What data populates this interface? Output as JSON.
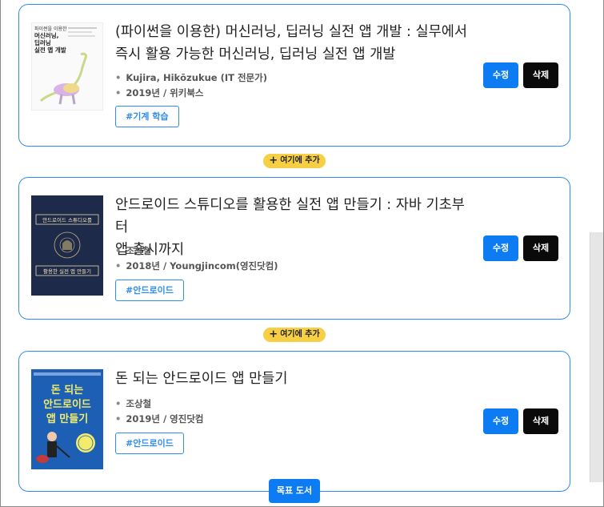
{
  "books": [
    {
      "title_line1": "(파이썬을 이용한) 머신러닝, 딥러닝 실전 앱 개발 : 실무에서",
      "title_line2": "즉시 활용 가능한 머신러닝, 딥러닝 실전 앱 개발",
      "author": "Kujira, Hikōzukue (IT 전문가)",
      "year_publisher": "2019년 / 위키북스",
      "tag": "#기계 학습",
      "cover_text": [
        "파이썬을 이용한",
        "머신러닝,",
        "딥러닝",
        "실전 앱 개발"
      ]
    },
    {
      "title_line1": "안드로이드 스튜디오를 활용한 실전 앱 만들기 : 자바 기초부터",
      "title_line2": "앱 출시까지",
      "author": "조상철",
      "year_publisher": "2018년 / Youngjincom(영진닷컴)",
      "tag": "#안드로이드",
      "cover_text": [
        "안드로이드 스튜디오를",
        "활용한 실전 앱 만들기"
      ]
    },
    {
      "title_line1": "돈 되는 안드로이드 앱 만들기",
      "title_line2": "",
      "author": "조상철",
      "year_publisher": "2019년 / 영진닷컴",
      "tag": "#안드로이드",
      "cover_text": [
        "돈 되는",
        "안드로이드",
        "앱 만들기"
      ]
    }
  ],
  "actions": {
    "edit_label": "수정",
    "delete_label": "삭제",
    "add_here_label": "여기에 추가",
    "goal_books_label": "목표 도서"
  },
  "colors": {
    "accent": "#0d7cf2",
    "card_border": "#2f8cf0",
    "add_pill": "#f7cf45",
    "delete": "#0a0a0a"
  }
}
